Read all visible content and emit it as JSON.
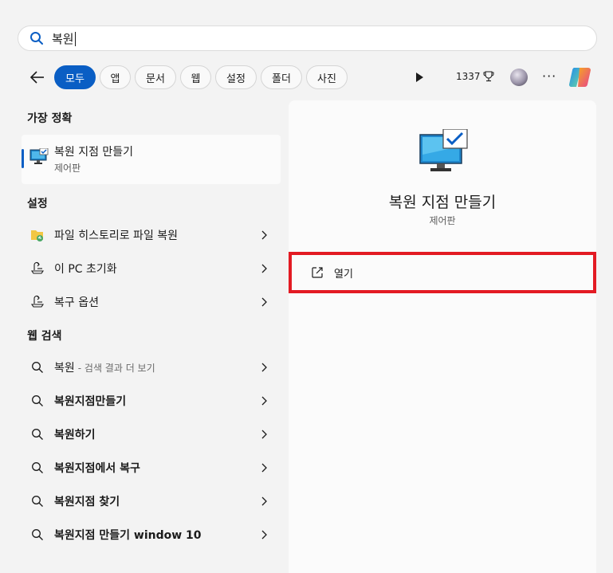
{
  "search": {
    "query": "복원"
  },
  "filters": [
    {
      "label": "모두",
      "active": true
    },
    {
      "label": "앱"
    },
    {
      "label": "문서"
    },
    {
      "label": "웹"
    },
    {
      "label": "설정"
    },
    {
      "label": "폴더"
    },
    {
      "label": "사진"
    }
  ],
  "toolbar": {
    "points": "1337"
  },
  "best_match": {
    "header": "가장 정확",
    "title": "복원 지점 만들기",
    "subtitle": "제어판"
  },
  "settings": {
    "header": "설정",
    "items": [
      {
        "label": "파일 히스토리로 파일 복원",
        "icon": "file-history-icon"
      },
      {
        "label": "이 PC 초기화",
        "icon": "reset-pc-icon"
      },
      {
        "label": "복구 옵션",
        "icon": "recovery-icon"
      }
    ]
  },
  "web": {
    "header": "웹 검색",
    "items": [
      {
        "label": "복원",
        "suffix": "- 검색 결과 더 보기",
        "bold": false
      },
      {
        "label": "복원지점만들기",
        "bold": true
      },
      {
        "label": "복원하기",
        "bold": true
      },
      {
        "label": "복원지점에서 복구",
        "bold": true
      },
      {
        "label": "복원지점 찾기",
        "bold": true
      },
      {
        "label": "복원지점 만들기 window 10",
        "bold": true
      }
    ]
  },
  "detail": {
    "title": "복원 지점 만들기",
    "subtitle": "제어판",
    "open_label": "열기"
  },
  "colors": {
    "accent": "#0a5ec4",
    "highlight": "#e31b23"
  }
}
